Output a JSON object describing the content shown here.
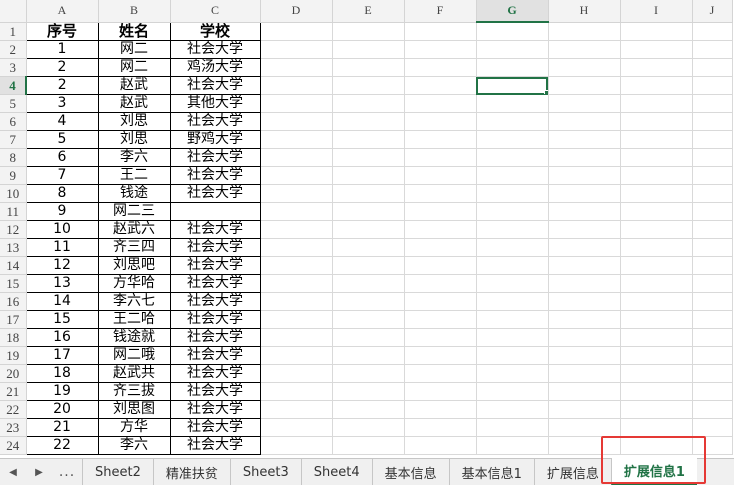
{
  "columns": [
    "A",
    "B",
    "C",
    "D",
    "E",
    "F",
    "G",
    "H",
    "I",
    "J"
  ],
  "active_column": "G",
  "active_row": 4,
  "header_row": {
    "a": "序号",
    "b": "姓名",
    "c": "学校"
  },
  "rows": [
    {
      "num": "2",
      "a": "1",
      "b": "网二",
      "c": "社会大学"
    },
    {
      "num": "3",
      "a": "2",
      "b": "网二",
      "c": "鸡汤大学"
    },
    {
      "num": "4",
      "a": "2",
      "b": "赵武",
      "c": "社会大学"
    },
    {
      "num": "5",
      "a": "3",
      "b": "赵武",
      "c": "其他大学"
    },
    {
      "num": "6",
      "a": "4",
      "b": "刘思",
      "c": "社会大学"
    },
    {
      "num": "7",
      "a": "5",
      "b": "刘思",
      "c": "野鸡大学"
    },
    {
      "num": "8",
      "a": "6",
      "b": "李六",
      "c": "社会大学"
    },
    {
      "num": "9",
      "a": "7",
      "b": "王二",
      "c": "社会大学"
    },
    {
      "num": "10",
      "a": "8",
      "b": "钱途",
      "c": "社会大学"
    },
    {
      "num": "11",
      "a": "9",
      "b": "网二三",
      "c": ""
    },
    {
      "num": "12",
      "a": "10",
      "b": "赵武六",
      "c": "社会大学"
    },
    {
      "num": "13",
      "a": "11",
      "b": "齐三四",
      "c": "社会大学"
    },
    {
      "num": "14",
      "a": "12",
      "b": "刘思吧",
      "c": "社会大学"
    },
    {
      "num": "15",
      "a": "13",
      "b": "方华哈",
      "c": "社会大学"
    },
    {
      "num": "16",
      "a": "14",
      "b": "李六七",
      "c": "社会大学"
    },
    {
      "num": "17",
      "a": "15",
      "b": "王二哈",
      "c": "社会大学"
    },
    {
      "num": "18",
      "a": "16",
      "b": "钱途就",
      "c": "社会大学"
    },
    {
      "num": "19",
      "a": "17",
      "b": "网二哦",
      "c": "社会大学"
    },
    {
      "num": "20",
      "a": "18",
      "b": "赵武共",
      "c": "社会大学"
    },
    {
      "num": "21",
      "a": "19",
      "b": "齐三拔",
      "c": "社会大学"
    },
    {
      "num": "22",
      "a": "20",
      "b": "刘思图",
      "c": "社会大学"
    },
    {
      "num": "23",
      "a": "21",
      "b": "方华",
      "c": "社会大学"
    },
    {
      "num": "24",
      "a": "22",
      "b": "李六",
      "c": "社会大学"
    }
  ],
  "tabs": {
    "nav_prev": "◀",
    "nav_next": "▶",
    "nav_more": "...",
    "items": [
      "Sheet2",
      "精准扶贫",
      "Sheet3",
      "Sheet4",
      "基本信息",
      "基本信息1",
      "扩展信息",
      "扩展信息1"
    ],
    "active_index": 7
  },
  "colors": {
    "accent": "#217346",
    "highlight": "#e53935"
  }
}
